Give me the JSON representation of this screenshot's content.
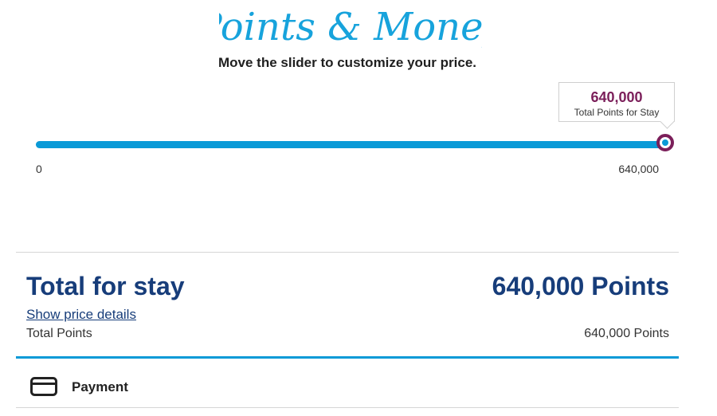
{
  "header": {
    "title": "Points & Money",
    "subtitle": "Move the slider to customize your price."
  },
  "slider": {
    "tooltip_value": "640,000",
    "tooltip_label": "Total Points for Stay",
    "min_label": "0",
    "max_label": "640,000",
    "fill_fraction": 1.0,
    "track_color": "#0a9ad7",
    "thumb_color": "#7b1f5a"
  },
  "summary": {
    "total_label": "Total for stay",
    "total_value": "640,000 Points",
    "details_link": "Show price details",
    "points_label": "Total Points",
    "points_value": "640,000 Points"
  },
  "payment": {
    "label": "Payment",
    "icon": "credit-card-icon"
  },
  "colors": {
    "brand_blue": "#173d7a",
    "accent_blue": "#0a9ad7",
    "purple": "#7b1f5a"
  }
}
